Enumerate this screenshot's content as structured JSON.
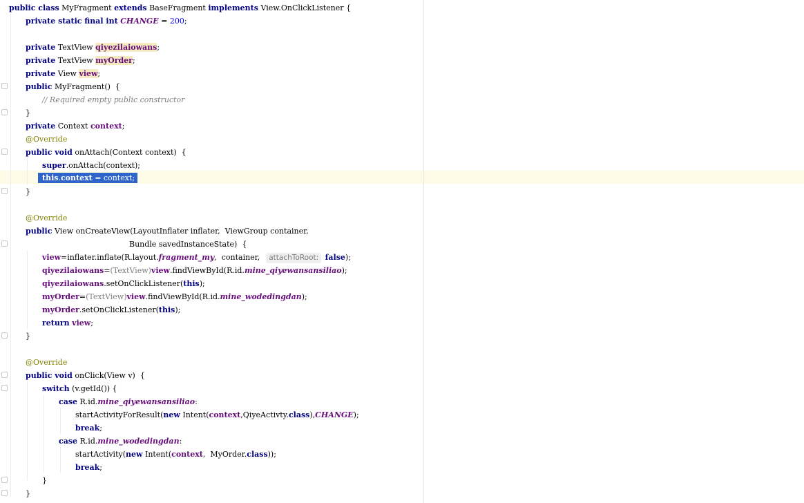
{
  "code": {
    "class_decl": {
      "kw1": "public class",
      "name": "MyFragment",
      "kw2": "extends",
      "base": "BaseFragment",
      "kw3": "implements",
      "iface": "View.OnClickListener {"
    },
    "const_decl": {
      "kw": "private static final int",
      "name": "CHANGE",
      "eq": " = ",
      "val": "200",
      "end": ";"
    },
    "field1": {
      "kw": "private",
      "type": "TextView",
      "name": "qiyezilaiowans",
      "end": ";"
    },
    "field2": {
      "kw": "private",
      "type": "TextView",
      "name": "myOrder",
      "end": ";"
    },
    "field3": {
      "kw": "private",
      "type": "View",
      "name": "view",
      "end": ";"
    },
    "ctor": {
      "kw": "public",
      "rest": "MyFragment()  {"
    },
    "ctor_comment": "// Required empty public constructor",
    "close1": "}",
    "ctx_field": {
      "kw": "private",
      "type": "Context",
      "name": "context",
      "end": ";"
    },
    "override1": "@Override",
    "attach_decl": {
      "kw": "public void",
      "rest": "onAttach(Context context)  {"
    },
    "super_call": {
      "kw": "super",
      "rest": ".onAttach(context);"
    },
    "this_ctx": {
      "kw": "this",
      "dot": ".",
      "fld": "context",
      "rest": " = context;"
    },
    "close2": "}",
    "override2": "@Override",
    "create_decl": {
      "kw": "public",
      "rest": "View onCreateView(LayoutInflater inflater,  ViewGroup container,"
    },
    "create_decl2": "Bundle savedInstanceState)  {",
    "inflate": {
      "fld": "view",
      "a": "=inflater.inflate(R.layout.",
      "res": "fragment_my",
      "b": ",  container,  ",
      "hint": "attachToRoot:",
      "kw": "false",
      "c": ");"
    },
    "find1": {
      "fld": "qiyezilaiowans",
      "a": "=",
      "cast": "(TextView)",
      "fld2": "view",
      "b": ".findViewById(R.id.",
      "res": "mine_qiyewansansiliao",
      "c": ");"
    },
    "listener1": {
      "fld": "qiyezilaiowans",
      "a": ".setOnClickListener(",
      "kw": "this",
      "b": ");"
    },
    "find2": {
      "fld": "myOrder",
      "a": "=",
      "cast": "(TextView)",
      "fld2": "view",
      "b": ".findViewById(R.id.",
      "res": "mine_wodedingdan",
      "c": ");"
    },
    "listener2": {
      "fld": "myOrder",
      "a": ".setOnClickListener(",
      "kw": "this",
      "b": ");"
    },
    "ret": {
      "kw": "return",
      "fld": "view",
      "end": ";"
    },
    "close3": "}",
    "override3": "@Override",
    "click_decl": {
      "kw": "public void",
      "rest": "onClick(View v)  {"
    },
    "switch_line": {
      "kw": "switch",
      "rest": " (v.getId()) {"
    },
    "case1": {
      "kw": "case",
      "a": " R.id.",
      "res": "mine_qiyewansansiliao",
      "b": ":"
    },
    "start1": {
      "a": "startActivityForResult(",
      "kw": "new",
      "b": " Intent(",
      "fld": "context",
      "c": ",QiyeActivty.",
      "kw2": "class",
      "d": "),",
      "cnst": "CHANGE",
      "e": ");"
    },
    "break1": "break",
    "case2": {
      "kw": "case",
      "a": " R.id.",
      "res": "mine_wodedingdan",
      "b": ":"
    },
    "start2": {
      "a": "startActivity(",
      "kw": "new",
      "b": " Intent(",
      "fld": "context",
      "c": ",  MyOrder.",
      "kw2": "class",
      "d": "));"
    },
    "break2": "break",
    "close4": "}",
    "close5": "}"
  }
}
